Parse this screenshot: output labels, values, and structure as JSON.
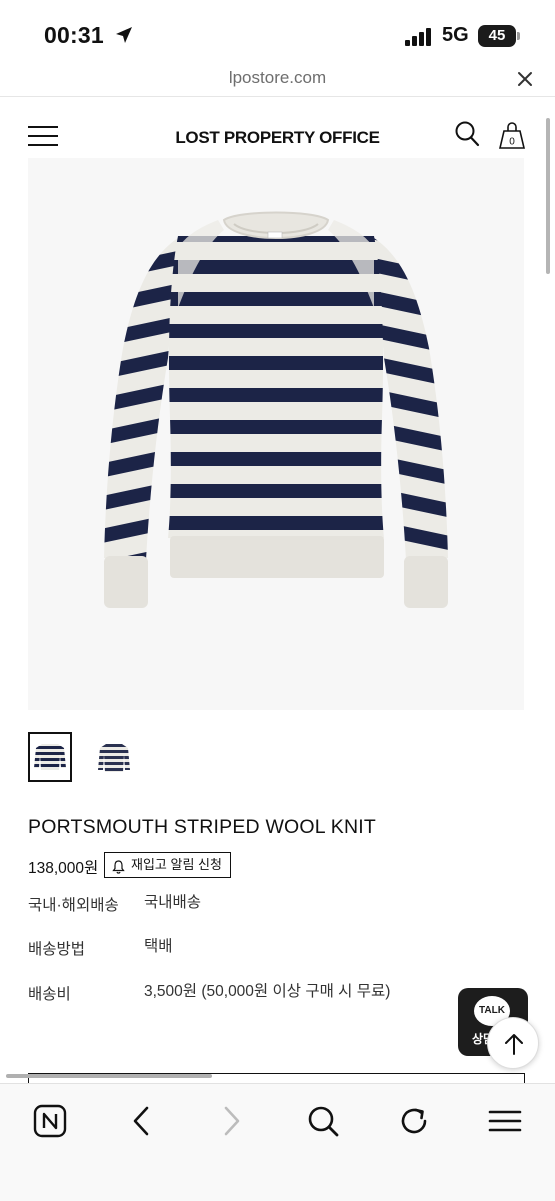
{
  "status_bar": {
    "time": "00:31",
    "network": "5G",
    "battery": "45"
  },
  "address_bar": {
    "url": "lpostore.com"
  },
  "site": {
    "brand": "LOST PROPERTY OFFICE",
    "cart_count": "0"
  },
  "product": {
    "name": "PORTSMOUTH STRIPED WOOL KNIT",
    "price": "138,000원",
    "restock_button": "재입고 알림 신청",
    "info": [
      {
        "label": "국내·해외배송",
        "value": "국내배송"
      },
      {
        "label": "배송방법",
        "value": "택배"
      },
      {
        "label": "배송비",
        "value": "3,500원 (50,000원 이상 구매 시 무료)"
      }
    ]
  },
  "floating": {
    "kakao_badge": "TALK",
    "kakao_label": "상담"
  },
  "colors": {
    "stripe_navy": "#1c2447",
    "knit_cream": "#ecebe6",
    "accent": "#111111"
  },
  "icons": {
    "status": [
      "location-arrow-icon",
      "signal-icon"
    ],
    "header": [
      "menu-icon",
      "search-icon",
      "shopping-bag-icon"
    ],
    "toolbar": [
      "naver-home-icon",
      "back-arrow-icon",
      "forward-arrow-icon",
      "search-icon",
      "refresh-icon",
      "menu-icon"
    ]
  }
}
